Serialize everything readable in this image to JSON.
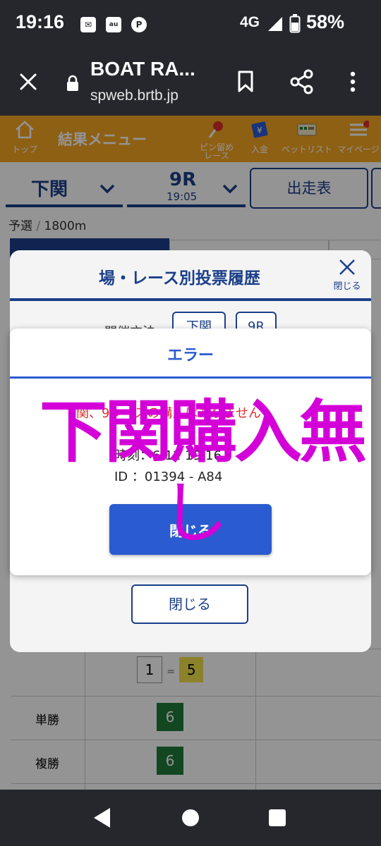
{
  "status_bar": {
    "time": "19:16",
    "network": "4G",
    "battery": "58%"
  },
  "browser": {
    "page_title": "BOAT RA...",
    "url": "spweb.brtb.jp"
  },
  "site_header": {
    "top_label": "トップ",
    "title": "結果メニュー",
    "pin_label_1": "ピン留め",
    "pin_label_2": "レース",
    "deposit_label": "入金",
    "bet_list_label": "ベットリスト",
    "my_page_label": "マイページ"
  },
  "race_selector": {
    "venue": "下関",
    "race_no": "9R",
    "race_time": "19:05",
    "entry_table_button": "出走表"
  },
  "race_info": {
    "race_type": "予選",
    "separator": "/",
    "distance": "1800m"
  },
  "background_table": {
    "combo": {
      "first": "1",
      "dash": "=",
      "second": "5"
    },
    "rows": [
      {
        "label": "単勝",
        "boat": "6"
      },
      {
        "label": "複勝",
        "boat": "6"
      }
    ]
  },
  "history_panel": {
    "title": "場・レース別投票履歴",
    "close_label": "閉じる",
    "filter_label": "開催方法",
    "filter_venue": "下関",
    "filter_race": "9R",
    "close_button": "閉じる"
  },
  "error_dialog": {
    "title": "エラー",
    "message": "下関、9レースの購入はありません",
    "time_line": "時刻：6/12 19:16",
    "id_line": "ID ：01394 - A84",
    "close_button": "閉じる"
  },
  "overlay_annotation": {
    "line1": "下関購入無",
    "line2": "し"
  },
  "colors": {
    "header_orange": "#f5a623",
    "brand_navy": "#1b3f8a",
    "dialog_blue": "#2b5bd0",
    "error_red": "#d9302c",
    "annotation_magenta": "#d400d8",
    "boat_green": "#1f7a3a",
    "boat_yellow": "#f2e04c"
  }
}
